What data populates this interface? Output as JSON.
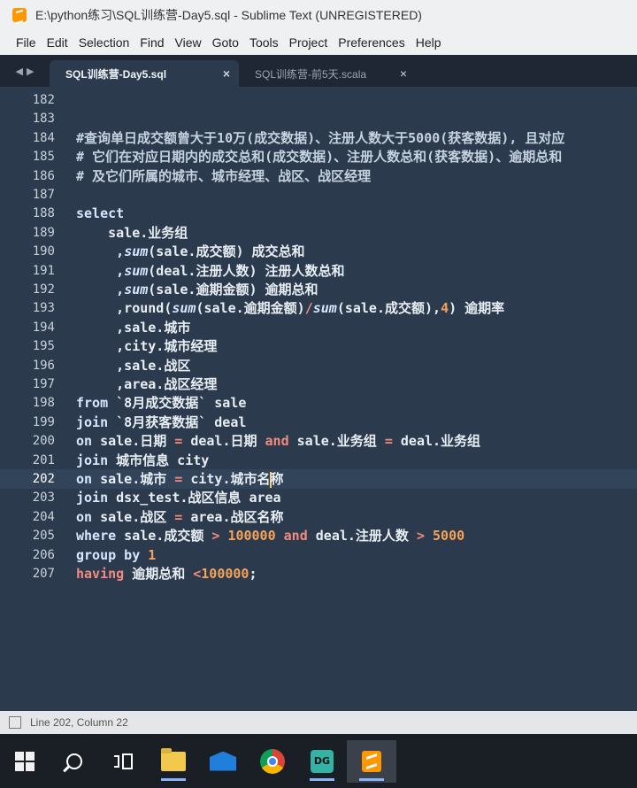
{
  "window": {
    "title": "E:\\python练习\\SQL训练营-Day5.sql - Sublime Text (UNREGISTERED)"
  },
  "menu": [
    "File",
    "Edit",
    "Selection",
    "Find",
    "View",
    "Goto",
    "Tools",
    "Project",
    "Preferences",
    "Help"
  ],
  "tabs": [
    {
      "label": "SQL训练营-Day5.sql",
      "active": true
    },
    {
      "label": "SQL训练营-前5天.scala",
      "active": false
    }
  ],
  "tab_close_glyph": "×",
  "tab_nav_glyphs": [
    "◀",
    "▶"
  ],
  "editor": {
    "current_line": "202",
    "lines": [
      {
        "num": "182",
        "tokens": []
      },
      {
        "num": "183",
        "tokens": []
      },
      {
        "num": "184",
        "tokens": [
          {
            "t": "#查询单日成交额曾大于10万(成交数据)、注册人数大于5000(获客数据), 且对应",
            "c": "cm"
          }
        ]
      },
      {
        "num": "185",
        "tokens": [
          {
            "t": "# 它们在对应日期内的成交总和(成交数据)、注册人数总和(获客数据)、逾期总和",
            "c": "cm"
          }
        ]
      },
      {
        "num": "186",
        "tokens": [
          {
            "t": "# 及它们所属的城市、城市经理、战区、战区经理",
            "c": "cm"
          }
        ]
      },
      {
        "num": "187",
        "tokens": []
      },
      {
        "num": "188",
        "tokens": [
          {
            "t": "select",
            "c": "kw"
          }
        ]
      },
      {
        "num": "189",
        "tokens": [
          {
            "t": "    sale.业务组",
            "c": ""
          }
        ]
      },
      {
        "num": "190",
        "tokens": [
          {
            "t": "     ,",
            "c": ""
          },
          {
            "t": "sum",
            "c": "fn"
          },
          {
            "t": "(sale.成交额) 成交总和",
            "c": ""
          }
        ]
      },
      {
        "num": "191",
        "tokens": [
          {
            "t": "     ,",
            "c": ""
          },
          {
            "t": "sum",
            "c": "fn"
          },
          {
            "t": "(deal.注册人数) 注册人数总和",
            "c": ""
          }
        ]
      },
      {
        "num": "192",
        "tokens": [
          {
            "t": "     ,",
            "c": ""
          },
          {
            "t": "sum",
            "c": "fn"
          },
          {
            "t": "(sale.逾期金额) 逾期总和",
            "c": ""
          }
        ]
      },
      {
        "num": "193",
        "tokens": [
          {
            "t": "     ,round(",
            "c": ""
          },
          {
            "t": "sum",
            "c": "fn"
          },
          {
            "t": "(sale.逾期金额)",
            "c": ""
          },
          {
            "t": "/",
            "c": "op"
          },
          {
            "t": "sum",
            "c": "fn"
          },
          {
            "t": "(sale.成交额),",
            "c": ""
          },
          {
            "t": "4",
            "c": "num"
          },
          {
            "t": ") 逾期率",
            "c": ""
          }
        ]
      },
      {
        "num": "194",
        "tokens": [
          {
            "t": "     ,sale.城市",
            "c": ""
          }
        ]
      },
      {
        "num": "195",
        "tokens": [
          {
            "t": "     ,city.城市经理",
            "c": ""
          }
        ]
      },
      {
        "num": "196",
        "tokens": [
          {
            "t": "     ,sale.战区",
            "c": ""
          }
        ]
      },
      {
        "num": "197",
        "tokens": [
          {
            "t": "     ,area.战区经理",
            "c": ""
          }
        ]
      },
      {
        "num": "198",
        "tokens": [
          {
            "t": "from",
            "c": "kw"
          },
          {
            "t": " `8月成交数据` sale",
            "c": ""
          }
        ]
      },
      {
        "num": "199",
        "tokens": [
          {
            "t": "join",
            "c": "kw"
          },
          {
            "t": " `8月获客数据` deal",
            "c": ""
          }
        ]
      },
      {
        "num": "200",
        "tokens": [
          {
            "t": "on",
            "c": "kw"
          },
          {
            "t": " sale.日期 ",
            "c": ""
          },
          {
            "t": "=",
            "c": "op"
          },
          {
            "t": " deal.日期 ",
            "c": ""
          },
          {
            "t": "and",
            "c": "op"
          },
          {
            "t": " sale.业务组 ",
            "c": ""
          },
          {
            "t": "=",
            "c": "op"
          },
          {
            "t": " deal.业务组",
            "c": ""
          }
        ]
      },
      {
        "num": "201",
        "tokens": [
          {
            "t": "join",
            "c": "kw"
          },
          {
            "t": " 城市信息 city",
            "c": ""
          }
        ]
      },
      {
        "num": "202",
        "tokens": [
          {
            "t": "on",
            "c": "kw"
          },
          {
            "t": " sale.城市 ",
            "c": ""
          },
          {
            "t": "=",
            "c": "op"
          },
          {
            "t": " city.城市名",
            "c": ""
          },
          {
            "t": "|",
            "c": "caret"
          },
          {
            "t": "称",
            "c": ""
          }
        ]
      },
      {
        "num": "203",
        "tokens": [
          {
            "t": "join",
            "c": "kw"
          },
          {
            "t": " dsx_test.战区信息 area",
            "c": ""
          }
        ]
      },
      {
        "num": "204",
        "tokens": [
          {
            "t": "on",
            "c": "kw"
          },
          {
            "t": " sale.战区 ",
            "c": ""
          },
          {
            "t": "=",
            "c": "op"
          },
          {
            "t": " area.战区名称",
            "c": ""
          }
        ]
      },
      {
        "num": "205",
        "tokens": [
          {
            "t": "where",
            "c": "kw"
          },
          {
            "t": " sale.成交额 ",
            "c": ""
          },
          {
            "t": ">",
            "c": "op"
          },
          {
            "t": " ",
            "c": ""
          },
          {
            "t": "100000",
            "c": "num"
          },
          {
            "t": " ",
            "c": ""
          },
          {
            "t": "and",
            "c": "op"
          },
          {
            "t": " deal.注册人数 ",
            "c": ""
          },
          {
            "t": ">",
            "c": "op"
          },
          {
            "t": " ",
            "c": ""
          },
          {
            "t": "5000",
            "c": "num"
          }
        ]
      },
      {
        "num": "206",
        "tokens": [
          {
            "t": "group by",
            "c": "kw"
          },
          {
            "t": " ",
            "c": ""
          },
          {
            "t": "1",
            "c": "num"
          }
        ]
      },
      {
        "num": "207",
        "tokens": [
          {
            "t": "having",
            "c": "op"
          },
          {
            "t": " 逾期总和 ",
            "c": ""
          },
          {
            "t": "<",
            "c": "op"
          },
          {
            "t": "100000",
            "c": "num"
          },
          {
            "t": ";",
            "c": ""
          }
        ]
      }
    ]
  },
  "status": {
    "position": "Line 202, Column 22"
  },
  "taskbar": [
    {
      "name": "windows-start-icon"
    },
    {
      "name": "search-icon"
    },
    {
      "name": "task-view-icon"
    },
    {
      "name": "file-explorer-icon"
    },
    {
      "name": "mail-icon"
    },
    {
      "name": "chrome-icon"
    },
    {
      "name": "datagrip-icon",
      "label": "DG"
    },
    {
      "name": "sublime-text-icon",
      "active": true
    }
  ]
}
